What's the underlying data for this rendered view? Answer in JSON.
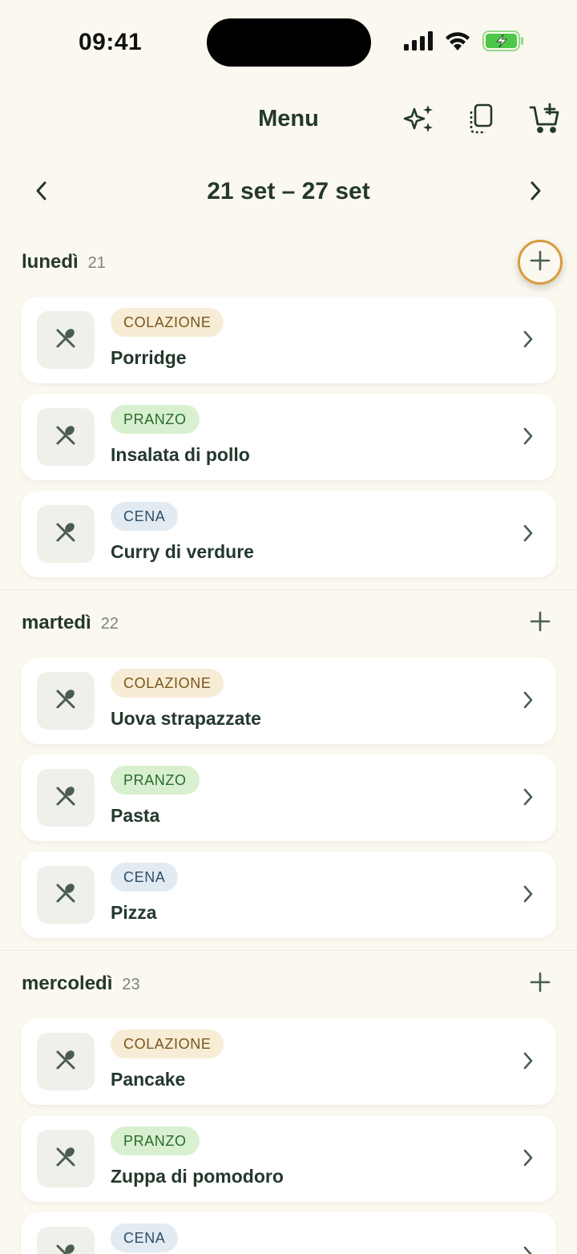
{
  "status": {
    "time": "09:41"
  },
  "header": {
    "title": "Menu",
    "icons": [
      "sparkles-icon",
      "copy-icon",
      "add-to-cart-icon"
    ]
  },
  "week": {
    "label": "21 set – 27 set"
  },
  "days": [
    {
      "name": "lunedì",
      "number": "21",
      "meals": [
        {
          "tag": "COLAZIONE",
          "name": "Porridge"
        },
        {
          "tag": "PRANZO",
          "name": "Insalata di pollo"
        },
        {
          "tag": "CENA",
          "name": "Curry di verdure"
        }
      ]
    },
    {
      "name": "martedì",
      "number": "22",
      "meals": [
        {
          "tag": "COLAZIONE",
          "name": "Uova strapazzate"
        },
        {
          "tag": "PRANZO",
          "name": "Pasta"
        },
        {
          "tag": "CENA",
          "name": "Pizza"
        }
      ]
    },
    {
      "name": "mercoledì",
      "number": "23",
      "meals": [
        {
          "tag": "COLAZIONE",
          "name": "Pancake"
        },
        {
          "tag": "PRANZO",
          "name": "Zuppa di pomodoro"
        },
        {
          "tag": "CENA",
          "name": ""
        }
      ]
    }
  ],
  "colors": {
    "background": "#fbf8ef",
    "text": "#24382c",
    "highlight_ring": "#d99b3d",
    "battery": "#4cc74a"
  }
}
